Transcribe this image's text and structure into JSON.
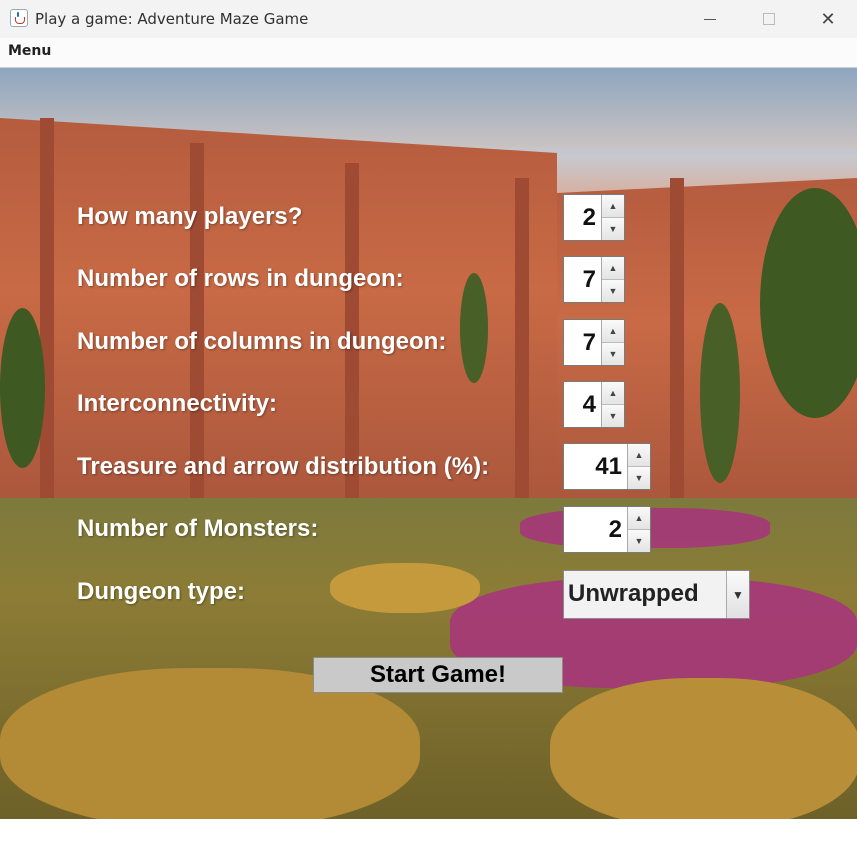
{
  "window": {
    "title": "Play a game: Adventure Maze Game",
    "minimize_glyph": "–",
    "maximize_glyph": "□",
    "close_glyph": "✕"
  },
  "menubar": {
    "items": [
      {
        "label": "Menu"
      }
    ]
  },
  "form": {
    "fields": [
      {
        "label": "How many players?",
        "value": "2"
      },
      {
        "label": "Number of rows in dungeon:",
        "value": "7"
      },
      {
        "label": "Number of columns in dungeon:",
        "value": "7"
      },
      {
        "label": "Interconnectivity:",
        "value": "4"
      },
      {
        "label": "Treasure and arrow distribution (%):",
        "value": "41"
      },
      {
        "label": "Number of Monsters:",
        "value": "2"
      }
    ],
    "dungeon_type": {
      "label": "Dungeon type:",
      "value": "Unwrapped"
    },
    "start_button": "Start Game!"
  },
  "icons": {
    "app": "java-cup-icon",
    "spin_up": "▲",
    "spin_down": "▼",
    "dropdown": "▼"
  },
  "colors": {
    "label_text": "#ffffff",
    "button_bg": "#c9c9c9"
  }
}
